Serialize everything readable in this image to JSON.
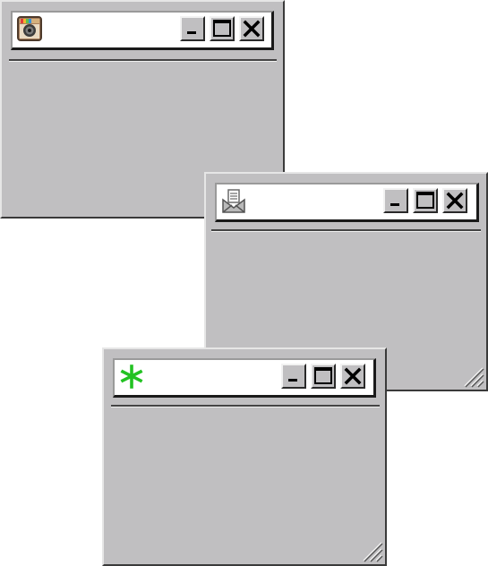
{
  "windows": [
    {
      "id": "camera",
      "title": "",
      "app_icon": "camera-app-icon",
      "controls": {
        "minimize": "minimize-icon",
        "maximize": "maximize-icon",
        "close": "close-icon"
      },
      "resize_grip": false
    },
    {
      "id": "mail",
      "title": "",
      "app_icon": "mail-envelope-icon",
      "controls": {
        "minimize": "minimize-icon",
        "maximize": "maximize-icon",
        "close": "close-icon"
      },
      "resize_grip": true
    },
    {
      "id": "asterisk",
      "title": "",
      "app_icon": "green-asterisk-icon",
      "controls": {
        "minimize": "minimize-icon",
        "maximize": "maximize-icon",
        "close": "close-icon"
      },
      "resize_grip": true
    }
  ],
  "colors": {
    "window_face": "#c0bfc1",
    "titlebar": "#ffffff",
    "asterisk_green": "#22c222",
    "desktop": "#ffffff"
  }
}
